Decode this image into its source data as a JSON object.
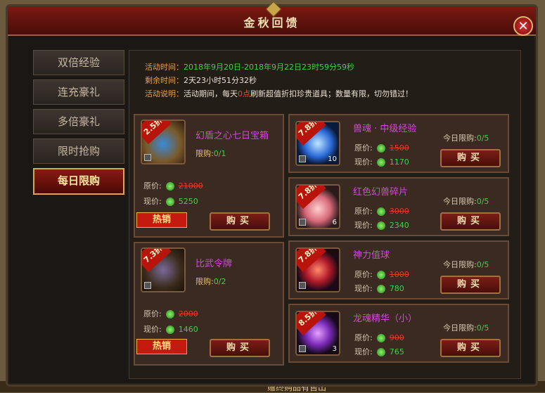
{
  "window": {
    "title": "金秋回馈"
  },
  "sidebar": {
    "items": [
      {
        "label": "双倍经验"
      },
      {
        "label": "连充豪礼"
      },
      {
        "label": "多倍豪礼"
      },
      {
        "label": "限时抢购"
      },
      {
        "label": "每日限购",
        "active": true
      }
    ]
  },
  "info": {
    "time_label": "活动时间：",
    "time_value": "2018年9月20日-2018年9月22日23时59分59秒",
    "remain_label": "剩余时间：",
    "remain_value": "2天23小时51分32秒",
    "desc_label": "活动说明：",
    "desc_pre": "活动期间，每天",
    "desc_red": "0点",
    "desc_post": "刷新超值折扣珍贵道具；数量有限，切勿错过！"
  },
  "labels": {
    "orig": "原价:",
    "now": "现价:",
    "buy": "购买",
    "hot": "热销",
    "limit": "限购:",
    "today": "今日限购:"
  },
  "items": [
    {
      "discount": "2.5折",
      "name": "幻盾之心七日宝箱",
      "limit": "0/1",
      "orig": "21000",
      "now": "5250",
      "qty": "",
      "icon": "treasure-chest-icon"
    },
    {
      "discount": "7.3折",
      "name": "比武令牌",
      "limit": "0/2",
      "orig": "2000",
      "now": "1460",
      "qty": "",
      "icon": "token-icon"
    },
    {
      "discount": "7.8折",
      "name": "兽魂 · 中级经验",
      "today": "0/5",
      "orig": "1500",
      "now": "1170",
      "qty": "10",
      "icon": "exp-orb-icon"
    },
    {
      "discount": "7.8折",
      "name": "红色幻兽碎片",
      "today": "0/5",
      "orig": "3000",
      "now": "2340",
      "qty": "6",
      "icon": "flower-icon"
    },
    {
      "discount": "7.8折",
      "name": "神力值球",
      "today": "0/5",
      "orig": "1000",
      "now": "780",
      "qty": "",
      "icon": "power-orb-icon"
    },
    {
      "discount": "8.5折",
      "name": "龙魂精华（小）",
      "today": "0/5",
      "orig": "900",
      "now": "765",
      "qty": "3",
      "icon": "dragon-essence-icon"
    }
  ],
  "background": {
    "text": "赠终购品有售出"
  },
  "colors": {
    "accent": "#b8140c",
    "green": "#3fd14a",
    "purple": "#d04ad8"
  }
}
